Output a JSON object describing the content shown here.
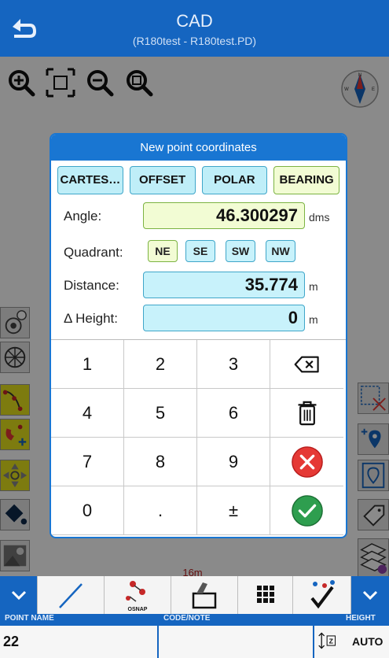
{
  "app": {
    "title": "CAD",
    "subtitle": "(R180test - R180test.PD)"
  },
  "dialog": {
    "title": "New point coordinates",
    "tabs": [
      {
        "label": "CARTES…",
        "active": false
      },
      {
        "label": "OFFSET",
        "active": false
      },
      {
        "label": "POLAR",
        "active": false
      },
      {
        "label": "BEARING",
        "active": true
      }
    ],
    "angle": {
      "label": "Angle:",
      "value": "46.300297",
      "unit": "dms"
    },
    "quadrant": {
      "label": "Quadrant:",
      "options": [
        "NE",
        "SE",
        "SW",
        "NW"
      ],
      "selected": "NE"
    },
    "distance": {
      "label": "Distance:",
      "value": "35.774",
      "unit": "m"
    },
    "height": {
      "label": "Δ Height:",
      "value": "0",
      "unit": "m"
    },
    "keys": [
      "1",
      "2",
      "3",
      "backspace",
      "4",
      "5",
      "6",
      "trash",
      "7",
      "8",
      "9",
      "cancel",
      "0",
      ".",
      "±",
      "confirm"
    ]
  },
  "canvas": {
    "scale_label": "16m"
  },
  "toolbar": {
    "osnap_label": "OSNAP"
  },
  "footer": {
    "point_name_header": "POINT NAME",
    "code_header": "CODE/NOTE",
    "height_header": "HEIGHT",
    "point_name_value": "22",
    "code_value": "",
    "height_mode": "AUTO"
  },
  "colors": {
    "primary": "#1565c0",
    "accent_green": "#2e9e4f",
    "cancel_red": "#e53935",
    "field_blue": "#c8f2fb",
    "field_active": "#f2fcd4"
  }
}
